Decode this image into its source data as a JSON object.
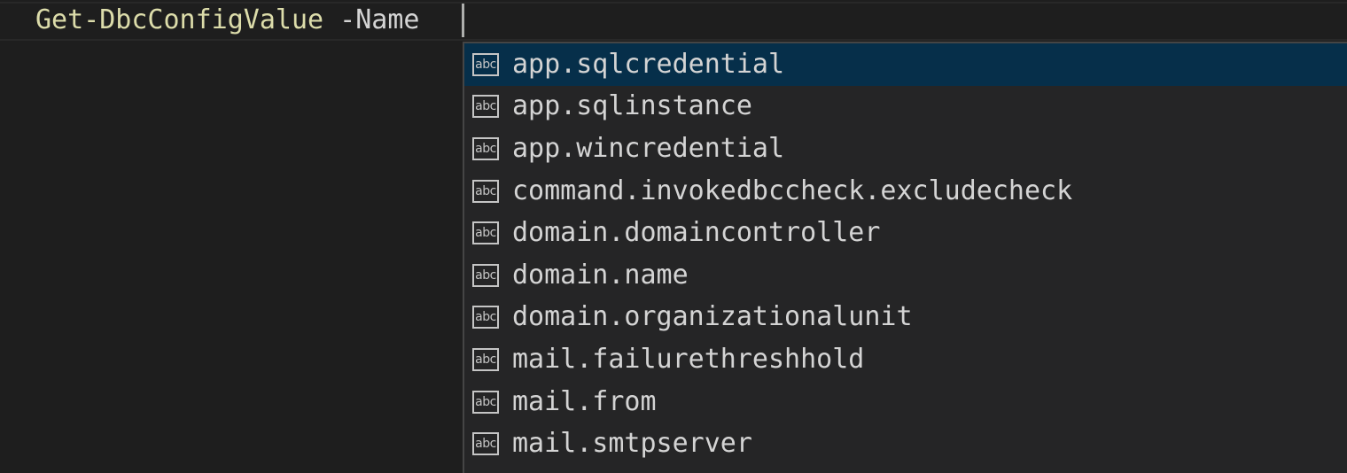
{
  "editor": {
    "command": "Get-DbcConfigValue",
    "parameter": "-Name"
  },
  "suggestions": {
    "icon": "abc-text-icon",
    "selected_index": 0,
    "items": [
      {
        "label": "app.sqlcredential",
        "icon_text": "abc"
      },
      {
        "label": "app.sqlinstance",
        "icon_text": "abc"
      },
      {
        "label": "app.wincredential",
        "icon_text": "abc"
      },
      {
        "label": "command.invokedbccheck.excludecheck",
        "icon_text": "abc"
      },
      {
        "label": "domain.domaincontroller",
        "icon_text": "abc"
      },
      {
        "label": "domain.name",
        "icon_text": "abc"
      },
      {
        "label": "domain.organizationalunit",
        "icon_text": "abc"
      },
      {
        "label": "mail.failurethreshhold",
        "icon_text": "abc"
      },
      {
        "label": "mail.from",
        "icon_text": "abc"
      },
      {
        "label": "mail.smtpserver",
        "icon_text": "abc"
      }
    ]
  },
  "colors": {
    "background": "#1e1e1e",
    "command": "#dcdcaa",
    "text": "#d4d4d4",
    "widget_background": "#252526",
    "selected_background": "#062f4a"
  }
}
